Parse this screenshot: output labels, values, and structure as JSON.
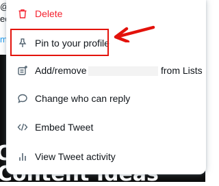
{
  "background": {
    "snippet_1": "@",
    "snippet_2": "edi",
    "snippet_3": "me",
    "overlay_line_1": "C",
    "overlay_line_2": "Content Ideas"
  },
  "menu": {
    "items": [
      {
        "label": "Delete",
        "icon": "trash-icon",
        "color": "#f4212e"
      },
      {
        "label": "Pin to your profile",
        "icon": "pin-icon"
      },
      {
        "label": "Add/remove",
        "label_suffix": "from Lists",
        "icon": "list-add-icon"
      },
      {
        "label": "Change who can reply",
        "icon": "speech-bubble-icon"
      },
      {
        "label": "Embed Tweet",
        "icon": "code-icon"
      },
      {
        "label": "View Tweet activity",
        "icon": "bar-chart-icon"
      }
    ]
  },
  "annotation": {
    "highlight_color": "#e3120b"
  }
}
